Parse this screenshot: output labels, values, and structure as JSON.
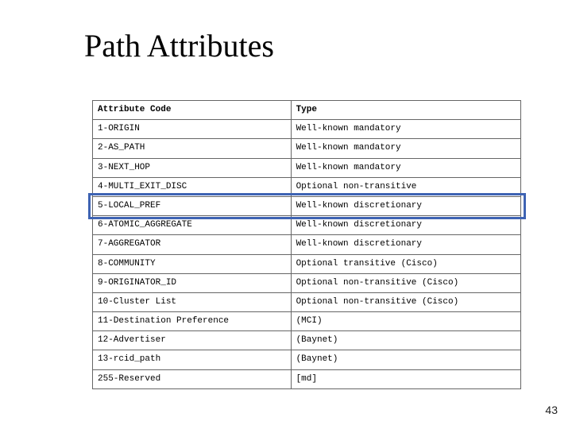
{
  "title": "Path Attributes",
  "page_number": "43",
  "table": {
    "headers": {
      "code": "Attribute Code",
      "type": "Type"
    },
    "rows": [
      {
        "code": "1-ORIGIN",
        "type": "Well-known mandatory"
      },
      {
        "code": "2-AS_PATH",
        "type": "Well-known mandatory"
      },
      {
        "code": "3-NEXT_HOP",
        "type": "Well-known mandatory"
      },
      {
        "code": "4-MULTI_EXIT_DISC",
        "type": "Optional non-transitive"
      },
      {
        "code": "5-LOCAL_PREF",
        "type": "Well-known discretionary"
      },
      {
        "code": "6-ATOMIC_AGGREGATE",
        "type": "Well-known discretionary"
      },
      {
        "code": "7-AGGREGATOR",
        "type": "Well-known discretionary"
      },
      {
        "code": "8-COMMUNITY",
        "type": "Optional transitive (Cisco)"
      },
      {
        "code": "9-ORIGINATOR_ID",
        "type": "Optional non-transitive (Cisco)"
      },
      {
        "code": "10-Cluster List",
        "type": "Optional non-transitive (Cisco)"
      },
      {
        "code": "11-Destination Preference",
        "type": "(MCI)"
      },
      {
        "code": "12-Advertiser",
        "type": "(Baynet)"
      },
      {
        "code": "13-rcid_path",
        "type": "(Baynet)"
      },
      {
        "code": "255-Reserved",
        "type": "[md]"
      }
    ],
    "highlight_row_index": 4
  }
}
